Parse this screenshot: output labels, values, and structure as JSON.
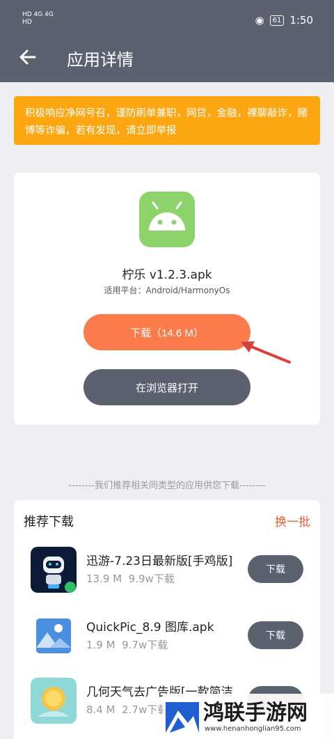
{
  "status_bar": {
    "left_line1": "HD 4G 4G",
    "left_line2": "HD",
    "battery": "61",
    "time": "1:50"
  },
  "header": {
    "title": "应用详情"
  },
  "warning": {
    "text": "积极响应净网号召，谨防刷单兼职，网贷，金融，裸聊敲诈，赌博等诈骗，若有发现，请立即举报"
  },
  "app": {
    "name": "柠乐 v1.2.3.apk",
    "platform": "适用平台：Android/HarmonyOs",
    "download_label": "下载（14.6 M）",
    "browser_label": "在浏览器打开"
  },
  "recommend": {
    "divider": "--------我们推荐相关同类型的应用供您下载--------",
    "title": "推荐下载",
    "refresh": "换一批",
    "items": [
      {
        "name": "迅游-7.23日最新版[手鸡版]",
        "size": "13.9 M",
        "downloads": "9.9w下载",
        "button": "下载"
      },
      {
        "name": "QuickPic_8.9 图库.apk",
        "size": "1.9 M",
        "downloads": "9.7w下载",
        "button": "下载"
      },
      {
        "name": "几何天气去广告版[一款简洁",
        "size": "8.4 M",
        "downloads": "2.7w下载",
        "button": "下载"
      }
    ]
  },
  "watermark": {
    "text": "鸿联手游网",
    "url": "www.henanhonglian95.com"
  }
}
